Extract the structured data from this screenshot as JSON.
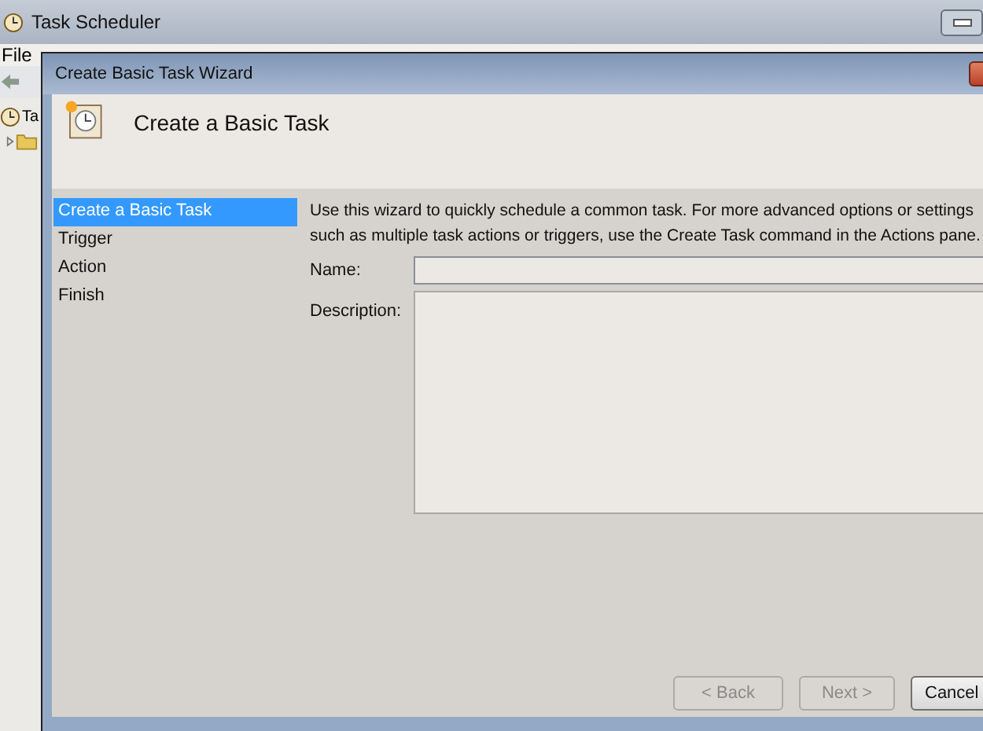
{
  "main_window": {
    "title": "Task Scheduler",
    "menu": [
      "File"
    ],
    "tree": [
      {
        "label": "Ta"
      }
    ]
  },
  "wizard": {
    "title": "Create Basic Task Wizard",
    "heading": "Create a Basic Task",
    "steps": [
      {
        "label": "Create a Basic Task",
        "selected": true
      },
      {
        "label": "Trigger",
        "selected": false
      },
      {
        "label": "Action",
        "selected": false
      },
      {
        "label": "Finish",
        "selected": false
      }
    ],
    "intro": "Use this wizard to quickly schedule a common task.  For more advanced options or settings such as multiple task actions or triggers, use the Create Task command in the Actions pane.",
    "fields": [
      {
        "label": "Name:",
        "kind": "line"
      },
      {
        "label": "Description:",
        "kind": "area"
      }
    ],
    "buttons": [
      {
        "label": "< Back",
        "disabled": true
      },
      {
        "label": "Next >",
        "disabled": true
      },
      {
        "label": "Cancel",
        "disabled": false
      }
    ]
  }
}
